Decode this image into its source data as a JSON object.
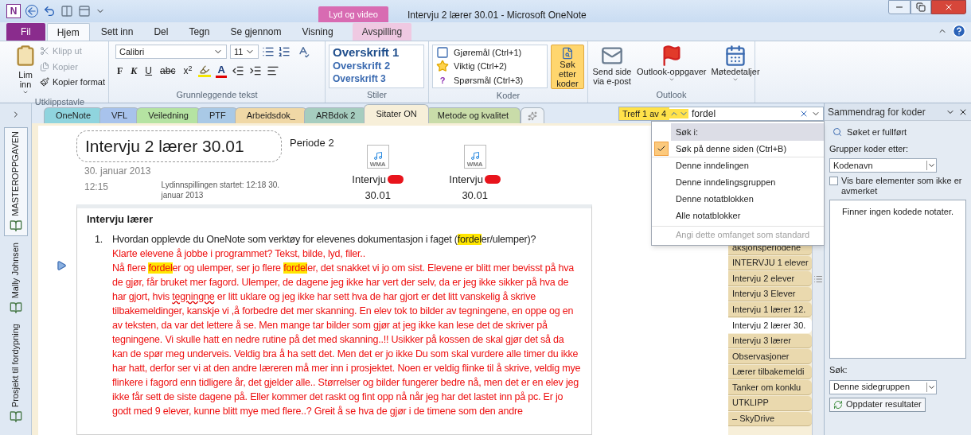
{
  "window": {
    "logo": "N",
    "context_group": "Lyd og video",
    "title": "Intervju 2 lærer 30.01 - Microsoft OneNote"
  },
  "ribbon_tabs": [
    {
      "label": "Fil",
      "kind": "file",
      "selected": false
    },
    {
      "label": "Hjem",
      "kind": "normal",
      "selected": true
    },
    {
      "label": "Sett inn",
      "kind": "normal",
      "selected": false
    },
    {
      "label": "Del",
      "kind": "normal",
      "selected": false
    },
    {
      "label": "Tegn",
      "kind": "normal",
      "selected": false
    },
    {
      "label": "Se gjennom",
      "kind": "normal",
      "selected": false
    },
    {
      "label": "Visning",
      "kind": "normal",
      "selected": false
    },
    {
      "label": "Avspilling",
      "kind": "context",
      "selected": false
    }
  ],
  "clipboard": {
    "title": "Utklippstavle",
    "paste": "Lim inn",
    "items": [
      {
        "label": "Klipp ut",
        "disabled": true
      },
      {
        "label": "Kopier",
        "disabled": true
      },
      {
        "label": "Kopier format",
        "disabled": false
      }
    ]
  },
  "basic_text": {
    "title": "Grunnleggende tekst",
    "font": "Calibri",
    "size": "11",
    "format_buttons": [
      "F",
      "K",
      "U",
      "abc",
      "x$^{2}$"
    ],
    "font_color_letter": "A"
  },
  "styles": {
    "title": "Stiler",
    "items": [
      "Overskrift 1",
      "Overskrift 2",
      "Overskrift 3"
    ]
  },
  "tags": {
    "title": "Koder",
    "items": [
      "Gjøremål (Ctrl+1)",
      "Viktig (Ctrl+2)",
      "Spørsmål (Ctrl+3)"
    ],
    "question_glyph": "?",
    "find": {
      "label": "Søk etter koder",
      "active": true
    }
  },
  "outlook": {
    "title": "Outlook",
    "items": [
      {
        "label": "Send side via e-post",
        "has_menu": false
      },
      {
        "label": "Outlook-oppgaver",
        "has_menu": true
      },
      {
        "label": "Møtedetaljer",
        "has_menu": true
      }
    ]
  },
  "notebooks": [
    {
      "name": "MASTEROPPGAVEN",
      "selected": true
    },
    {
      "name": "Mally Johnsen",
      "selected": false
    },
    {
      "name": "Prosjekt til fordypning",
      "selected": false
    }
  ],
  "sections": [
    {
      "name": "OneNote",
      "color": "#8fd4de",
      "selected": false
    },
    {
      "name": "VFL",
      "color": "#a8c3ec",
      "selected": false
    },
    {
      "name": "Veiledning",
      "color": "#b5e3a2",
      "selected": false
    },
    {
      "name": "PTF",
      "color": "#a9c9e6",
      "selected": false
    },
    {
      "name": "Arbeidsdok_",
      "color": "#f0d8a6",
      "selected": false
    },
    {
      "name": "ARBdok 2",
      "color": "#a6cdbf",
      "selected": false
    },
    {
      "name": "Sitater ON",
      "color": "#f7efd9",
      "selected": true
    },
    {
      "name": "Metode og kvalitet",
      "color": "#c9dca9",
      "selected": false
    }
  ],
  "search": {
    "hits": "Treff 1 av 4",
    "query": "fordel"
  },
  "scope_menu": {
    "header": "Søk i:",
    "items": [
      {
        "label": "Søk på denne siden (Ctrl+B)",
        "checked": true
      },
      {
        "label": "Denne inndelingen",
        "checked": false
      },
      {
        "label": "Denne inndelingsgruppen",
        "checked": false
      },
      {
        "label": "Denne notatblokken",
        "checked": false
      },
      {
        "label": "Alle notatblokker",
        "checked": false
      }
    ],
    "default_option": {
      "label": "Angi dette omfanget som standard",
      "disabled": true
    }
  },
  "page": {
    "title": "Intervju 2 lærer 30.01",
    "side_note": "Periode 2",
    "date": "30. januar 2013",
    "time": "12:15",
    "recording_note": "Lydinnspillingen startet: 12:18 30. januar 2013",
    "attachments": [
      {
        "badge": "WMA",
        "name": "Intervju",
        "date": "30.01"
      },
      {
        "badge": "WMA",
        "name": "Intervju",
        "date": "30.01"
      }
    ],
    "outline": {
      "heading": "Intervju lærer",
      "number": "1.",
      "question": [
        {
          "text": "Hvordan opplevde du OneNote som verktøy for elevenes dokumentasjon i faget (",
          "highlight": false,
          "misspelled": false
        },
        {
          "text": "fordel",
          "highlight": true,
          "misspelled": false
        },
        {
          "text": "er/ulemper)?",
          "highlight": false,
          "misspelled": false
        }
      ],
      "answer_lines": [
        [
          {
            "text": "Klarte elevene å jobbe i programmet? Tekst, bilde, lyd, filer..",
            "highlight": false,
            "misspelled": false
          }
        ],
        [
          {
            "text": "Nå flere ",
            "highlight": false,
            "misspelled": false
          },
          {
            "text": "fordel",
            "highlight": true,
            "misspelled": false
          },
          {
            "text": "er og ulemper, ser jo flere ",
            "highlight": false,
            "misspelled": false
          },
          {
            "text": "fordel",
            "highlight": true,
            "misspelled": false
          },
          {
            "text": "er, det snakket vi jo om sist. Elevene er blitt mer bevisst på hva de gjør, får bruket mer fagord. Ulemper, de dagene jeg ikke har vert der selv, da er jeg ikke sikker på hva de har gjort, hvis ",
            "highlight": false,
            "misspelled": false
          },
          {
            "text": "tegningne",
            "highlight": false,
            "misspelled": true
          },
          {
            "text": " er litt uklare og jeg ikke har sett hva de har gjort er det litt vanskelig å skrive tilbakemeldinger, kanskje vi ,å forbedre det mer skanning. En elev tok to bilder av tegningene, en oppe og en av teksten, da var det lettere å se. Men mange tar bilder som gjør at jeg ikke kan lese det de skriver på tegningene. Vi skulle hatt en nedre rutine på det med skanning..!! Usikker på kossen de skal gjør det så da kan de spør meg underveis. Veldig bra å ha sett det. Men det er jo ikke Du som skal vurdere alle timer du ikke har hatt, derfor ser vi at den andre læreren må mer inn i prosjektet. Noen er veldig flinke til å skrive, veldig mye flinkere i fagord enn tidligere år, det gjelder alle.. Størrelser og bilder fungerer bedre nå, men det er en elev jeg ikke får sett de siste dagene på. Eller kommer det raskt og fint opp nå når jeg har det lastet inn på pc. Er jo godt med 9 elever, kunne blitt mye med flere..? Greit å se hva de gjør i de timene som den andre",
            "highlight": false,
            "misspelled": false
          }
        ]
      ]
    }
  },
  "pages": [
    {
      "title": "aksjonsperiodene",
      "selected": false
    },
    {
      "title": "INTERVJU 1 elever",
      "selected": false
    },
    {
      "title": "Intervju 2 elever",
      "selected": false
    },
    {
      "title": "Intervju 3 Elever",
      "selected": false
    },
    {
      "title": "Intervju 1 lærer 12.",
      "selected": false
    },
    {
      "title": "Intervju 2 lærer 30.",
      "selected": true
    },
    {
      "title": "Intervju 3 lærer",
      "selected": false
    },
    {
      "title": "Observasjoner",
      "selected": false
    },
    {
      "title": "Lærer tilbakemeldi",
      "selected": false
    },
    {
      "title": "Tanker om konklu",
      "selected": false
    },
    {
      "title": "UTKLIPP",
      "selected": false
    },
    {
      "title": "– SkyDrive",
      "selected": false
    }
  ],
  "task_pane": {
    "title": "Sammendrag for koder",
    "status": "Søket er fullført",
    "group_label": "Grupper koder etter:",
    "group_value": "Kodenavn",
    "unchecked_only": {
      "label": "Vis bare elementer som ikke er avmerket",
      "checked": false
    },
    "results_empty": "Finner ingen kodede notater.",
    "search_label": "Søk:",
    "search_value": "Denne sidegruppen",
    "refresh": "Oppdater resultater"
  }
}
